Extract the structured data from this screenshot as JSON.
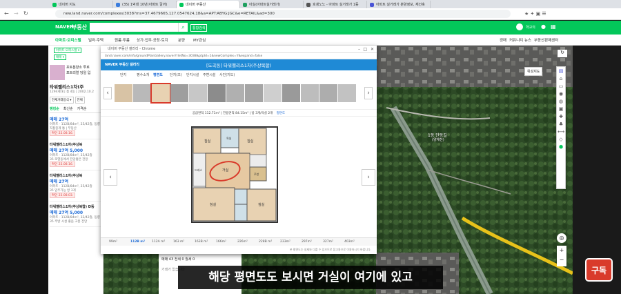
{
  "browser": {
    "tabs": [
      {
        "label": "네이버 지도",
        "color": "#03c75a",
        "active": false
      },
      {
        "label": "(35) 1억대 10년(아파트 갈까)",
        "color": "#3b7ddd",
        "active": false
      },
      {
        "label": "네이버 부동산",
        "color": "#03c75a",
        "active": true
      },
      {
        "label": "아실(아파트실거래가)",
        "color": "#20a060",
        "active": false
      },
      {
        "label": "호갱노노 - 아파트 실거래가 1등",
        "color": "#555555",
        "active": false
      },
      {
        "label": "아파트 실거래가 분양정보, 재건축",
        "color": "#4a54d6",
        "active": false
      }
    ],
    "url": "new.land.naver.com/complexes/3038?ms=37.4679665,127.0547624,18&a=APT:ABYG:JGC&e=RETAIL&ad=300"
  },
  "header": {
    "logo": "NAVER",
    "service": "부동산",
    "search_placeholder": "",
    "search_icon": "search-icon",
    "combined_search": "통합검색",
    "user_label": "학교의"
  },
  "menu": {
    "left": [
      "아파트·오피스텔",
      "빌라·주택",
      "원룸·투룸",
      "상가·업무·공장·토지",
      "분양",
      "MY관심"
    ],
    "right": [
      "경매",
      "커뮤니티",
      "뉴스",
      "부동산판매센터"
    ]
  },
  "filters": [
    "아파트·오피스텔 ▾",
    "매매 ▾"
  ],
  "listing": {
    "complex_name": "타워팰리스1차(주",
    "complex_meta": "1294세대 | 총 4동 | 2002.10.2",
    "promo": [
      "포토분양소 투로",
      "포트리얼 당일 입"
    ],
    "sort": [
      "전체거래방식 ▾",
      "전체"
    ],
    "tabs": [
      "랭킹순",
      "최신순",
      "가격순"
    ],
    "items": [
      {
        "type": "매매",
        "price": "27억",
        "meta": "아파트 · 112B/84m², 25/42층, 동향",
        "desc": "직접중개 통 | 부동산",
        "badge": "확인 22.08.16."
      },
      {
        "name": "타워팰리스1차(주상복",
        "type": "매매",
        "price": "27억 5,000",
        "meta": "아파트 · 112B/84m², 25/42층",
        "desc": "35 로열동에서 전망좋은 전망",
        "badge": "확인 22.08.16."
      },
      {
        "name": "타워팰리스1차(주상복",
        "type": "매매",
        "price": "27억",
        "meta": "아파트 · 112B/84m², 25/42층",
        "desc": "35 입주가능 방 3개",
        "badge": "확인 22.08.03."
      },
      {
        "name": "타워팰리스1차(주상복합) D동",
        "type": "매매",
        "price": "27억 5,000",
        "meta": "아파트 · 112B/84m², 32/42층, 동향",
        "desc": "35 주방 시설 좋음 고층 전망",
        "badge": ""
      }
    ]
  },
  "popup": {
    "window_title": "네이버 부동산 갤러리 - Chrome",
    "url": "land.naver.com/info/groundPlanGallery.naver?rletNo=3038&ptpId=1&newComplex=Y&expand=false",
    "header_logo": "NAVER 부동산 갤러리",
    "header_title": "[도곡동] 타워팰리스1차(주상복합)",
    "tabs": [
      "단지",
      "평수소개",
      "평면도",
      "단지(조)",
      "단지시설",
      "주변시설",
      "사진(지도)"
    ],
    "info": "공급면적 112.71m²  |  전용면적 84.15m²  |  방 3개/욕실 2개",
    "info_link": "평면도",
    "plan_highlight": "거실",
    "sizes": [
      "99m²",
      "112B m²",
      "112A m²",
      "163 m²",
      "163B m²",
      "166m²",
      "226m²",
      "228B m²",
      "233m²",
      "297m²",
      "327m²",
      "403m²"
    ],
    "active_size": 1,
    "footer": "본 평면도는 실제와 다를 수 있으므로 참고용으로 이용하시기 바랍니다."
  },
  "map": {
    "labels": [
      "1동 단동길",
      "(양재천)"
    ],
    "map_type": "위성지도"
  },
  "bottom_card": {
    "rows": [
      "매매 43  전세 0  월세 0",
      "거래가 없습니다"
    ]
  },
  "subtitle": "해당 평면도도 보시면 거실이 여기에 있고",
  "channel_badge": "구독"
}
